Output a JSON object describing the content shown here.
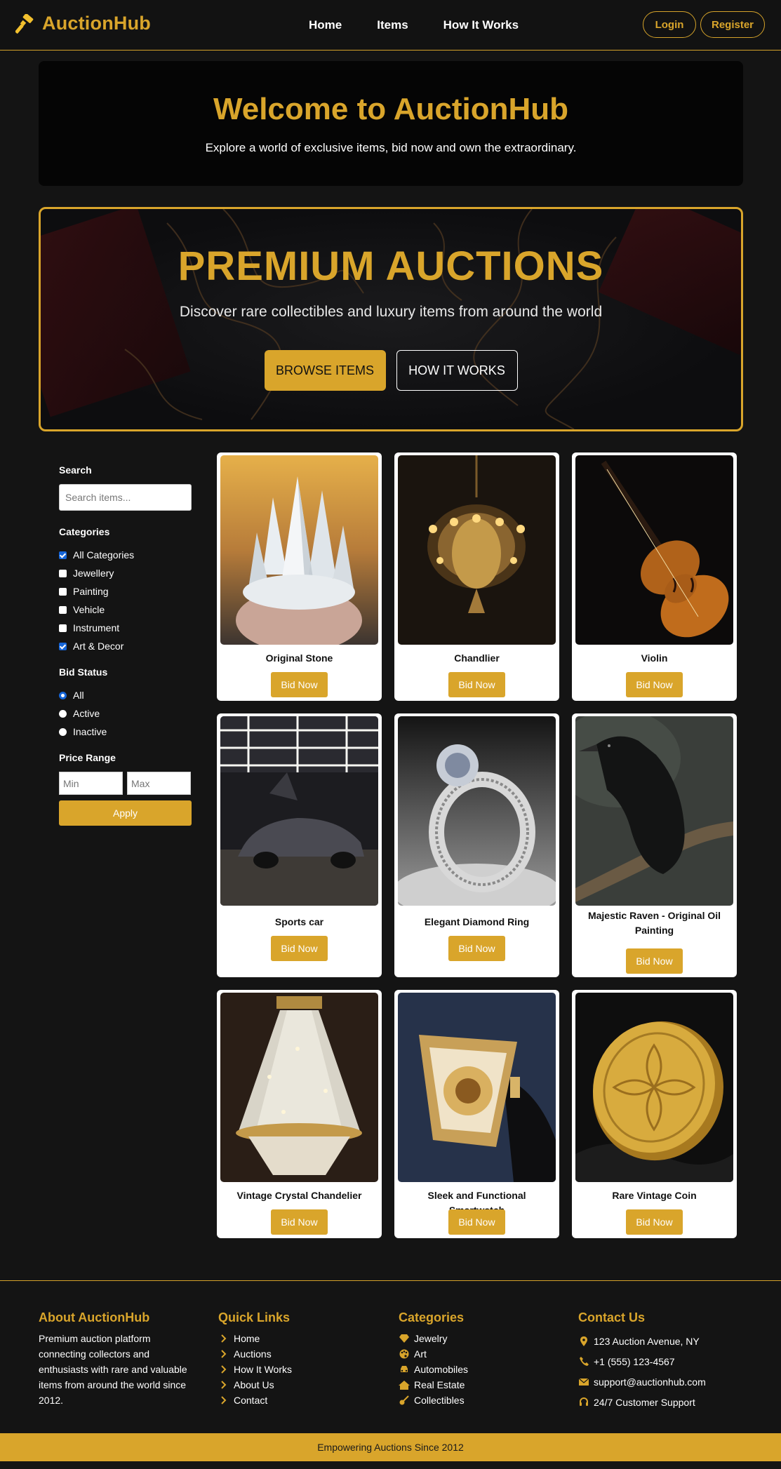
{
  "brand": {
    "name": "AuctionHub"
  },
  "nav": {
    "links": [
      "Home",
      "Items",
      "How It Works"
    ],
    "login": "Login",
    "register": "Register"
  },
  "welcome": {
    "title": "Welcome to AuctionHub",
    "subtitle": "Explore a world of exclusive items, bid now and own the extraordinary."
  },
  "hero": {
    "title": "PREMIUM AUCTIONS",
    "subtitle": "Discover rare collectibles and luxury items from around the world",
    "browse": "BROWSE ITEMS",
    "how": "HOW IT WORKS"
  },
  "filters": {
    "search_label": "Search",
    "search_placeholder": "Search items...",
    "categories_label": "Categories",
    "categories": [
      {
        "label": "All Categories",
        "checked": true
      },
      {
        "label": "Jewellery",
        "checked": false
      },
      {
        "label": "Painting",
        "checked": false
      },
      {
        "label": "Vehicle",
        "checked": false
      },
      {
        "label": "Instrument",
        "checked": false
      },
      {
        "label": "Art & Decor",
        "checked": true
      }
    ],
    "bid_status_label": "Bid Status",
    "bid_status": [
      {
        "label": "All",
        "selected": true
      },
      {
        "label": "Active",
        "selected": false
      },
      {
        "label": "Inactive",
        "selected": false
      }
    ],
    "price_label": "Price Range",
    "min_placeholder": "Min",
    "max_placeholder": "Max",
    "apply": "Apply"
  },
  "items": [
    {
      "title": "Original Stone",
      "image": "crystal-stone"
    },
    {
      "title": "Chandlier",
      "image": "chandelier"
    },
    {
      "title": "Violin",
      "image": "violin"
    },
    {
      "title": "Sports car",
      "image": "sports-car"
    },
    {
      "title": "Elegant Diamond Ring",
      "image": "diamond-ring"
    },
    {
      "title": "Majestic Raven - Original Oil Painting",
      "image": "raven-painting"
    },
    {
      "title": "Vintage Crystal Chandelier",
      "image": "crystal-chandelier"
    },
    {
      "title": "Sleek and Functional Smartwatch",
      "image": "smartwatch"
    },
    {
      "title": "Rare Vintage Coin",
      "image": "gold-coin"
    }
  ],
  "bid_label": "Bid Now",
  "footer": {
    "about_title": "About AuctionHub",
    "about_text": "Premium auction platform connecting collectors and enthusiasts with rare and valuable items from around the world since 2012.",
    "links_title": "Quick Links",
    "links": [
      "Home",
      "Auctions",
      "How It Works",
      "About Us",
      "Contact"
    ],
    "categories_title": "Categories",
    "categories": [
      {
        "label": "Jewelry",
        "icon": "gem-icon"
      },
      {
        "label": "Art",
        "icon": "palette-icon"
      },
      {
        "label": "Automobiles",
        "icon": "car-icon"
      },
      {
        "label": "Real Estate",
        "icon": "home-icon"
      },
      {
        "label": "Collectibles",
        "icon": "guitar-icon"
      }
    ],
    "contact_title": "Contact Us",
    "contact": [
      {
        "label": "123 Auction Avenue, NY",
        "icon": "map-pin-icon"
      },
      {
        "label": "+1 (555) 123-4567",
        "icon": "phone-icon"
      },
      {
        "label": "support@auctionhub.com",
        "icon": "envelope-icon"
      },
      {
        "label": "24/7 Customer Support",
        "icon": "headset-icon"
      }
    ],
    "bottom": "Empowering Auctions Since 2012"
  },
  "colors": {
    "accent": "#d9a52b",
    "background": "#141414",
    "card": "#ffffff"
  }
}
